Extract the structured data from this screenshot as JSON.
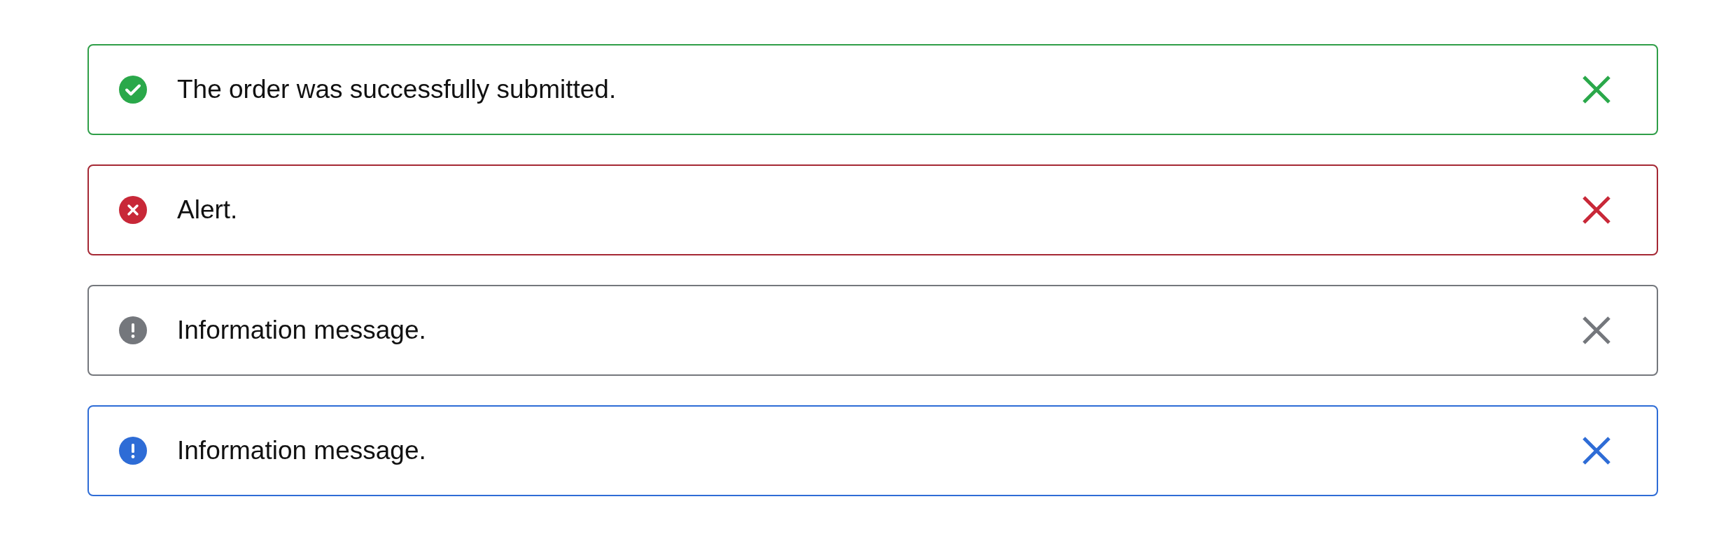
{
  "alerts": [
    {
      "kind": "success",
      "message": "The order was successfully submitted."
    },
    {
      "kind": "error",
      "message": "Alert."
    },
    {
      "kind": "neutral",
      "message": "Information message."
    },
    {
      "kind": "info",
      "message": "Information message."
    }
  ]
}
